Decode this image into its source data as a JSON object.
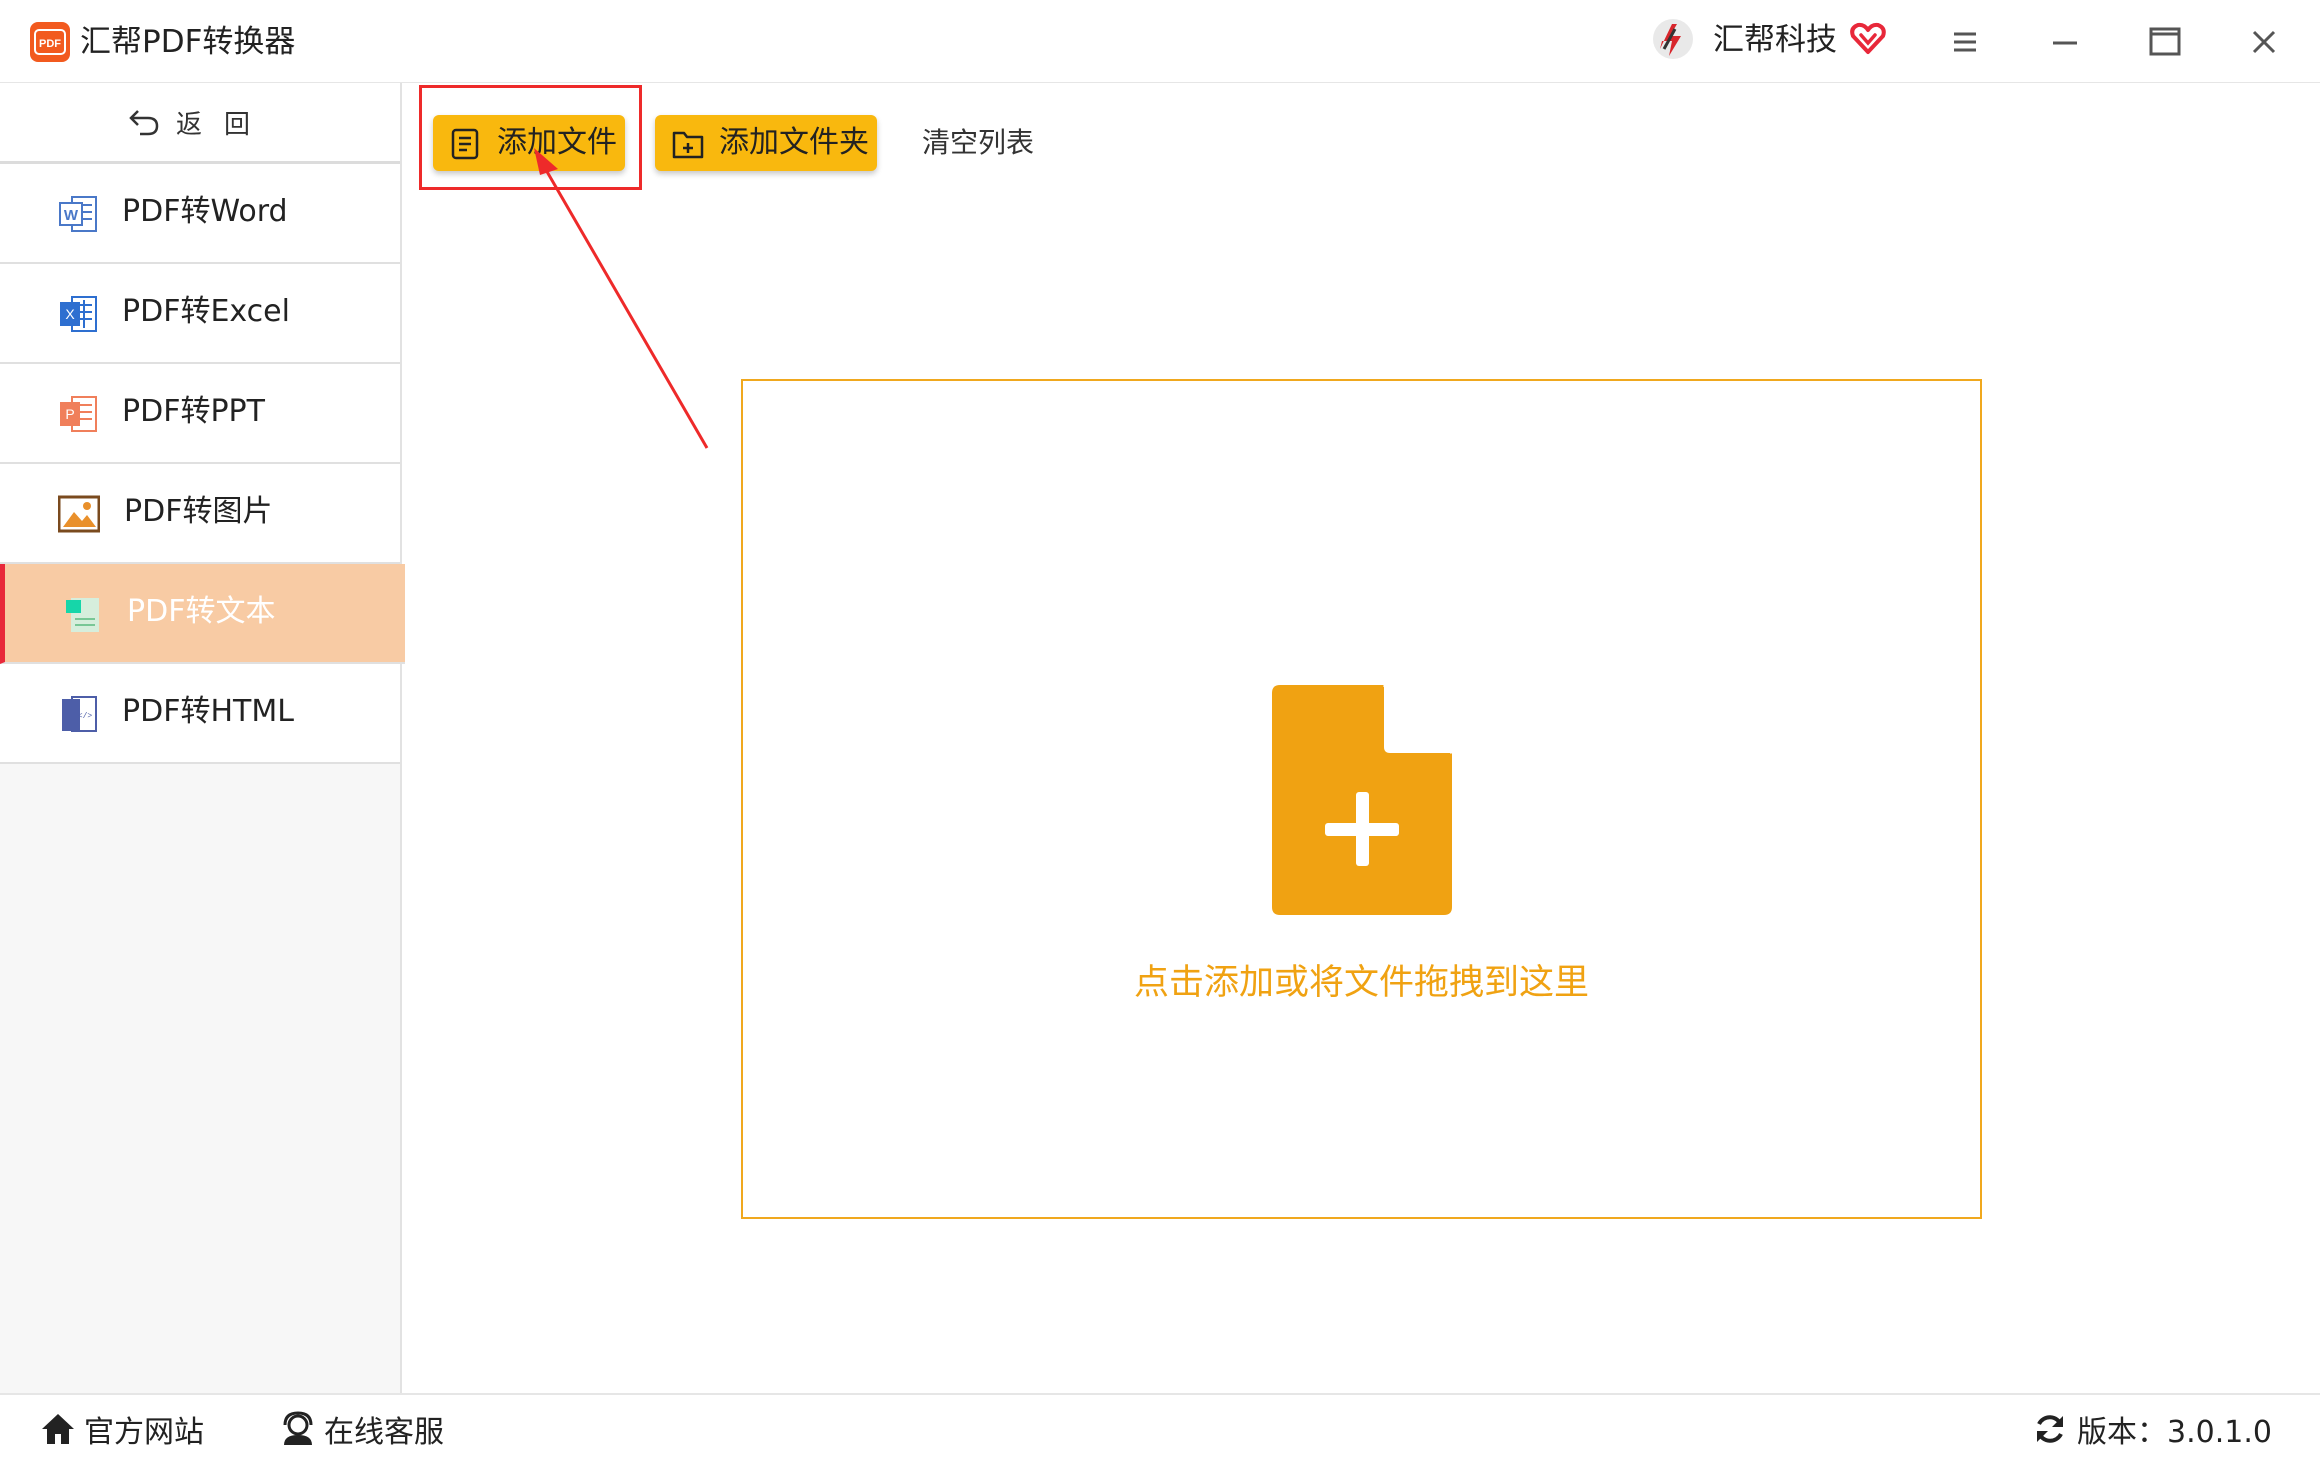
{
  "window": {
    "app_title": "汇帮PDF转换器",
    "brand_name": "汇帮科技",
    "logo_text": "PDF"
  },
  "sidebar": {
    "back_label": "返回",
    "items": [
      {
        "label": "PDF转Word",
        "icon": "word-icon"
      },
      {
        "label": "PDF转Excel",
        "icon": "excel-icon"
      },
      {
        "label": "PDF转PPT",
        "icon": "ppt-icon"
      },
      {
        "label": "PDF转图片",
        "icon": "image-icon"
      },
      {
        "label": "PDF转文本",
        "icon": "text-icon",
        "active": true
      },
      {
        "label": "PDF转HTML",
        "icon": "html-icon"
      }
    ]
  },
  "toolbar": {
    "add_file_label": "添加文件",
    "add_folder_label": "添加文件夹",
    "clear_list_label": "清空列表"
  },
  "dropzone": {
    "hint": "点击添加或将文件拖拽到这里"
  },
  "footer": {
    "website_label": "官方网站",
    "support_label": "在线客服",
    "version_label": "版本：3.0.1.0"
  },
  "colors": {
    "accent_yellow": "#f9b80e",
    "drop_orange": "#f0a212",
    "active_item_bg": "#f8cba4",
    "active_item_bar": "#e8283a",
    "annotation_red": "#ee2a2a",
    "logo_orange": "#f25a1f"
  }
}
